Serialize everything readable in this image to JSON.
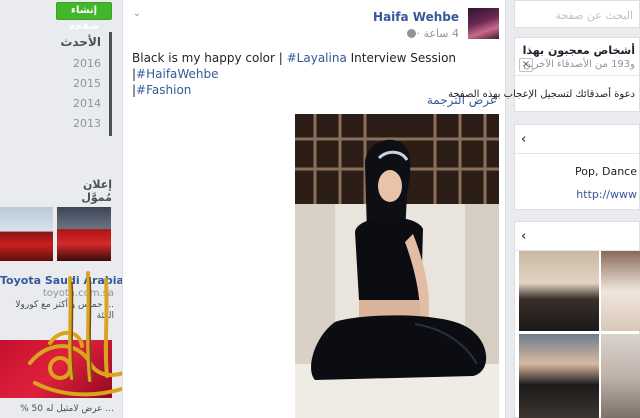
{
  "left": {
    "create_page": "إنشاء صفحة",
    "years": [
      "الأحدث",
      "2016",
      "2015",
      "2014",
      "2013"
    ],
    "sponsored": "إعلان مُموَّل",
    "ad_title": "Toyota Saudi Arabia",
    "ad_url": "toyota.com.sa",
    "ad_desc": "... حماس و أكثر مع كورولا الفئة",
    "ad_footer": "... عرض لامثيل له 50 %"
  },
  "post": {
    "author": "Haifa Wehbe",
    "time": "4 ساعة ·",
    "text_plain1": "Black is my happy color | ",
    "tag1": "#Layalina",
    "text_plain2": " Interview Session |",
    "tag2": "#HaifaWehbe",
    "text_plain3": " |",
    "tag3": "#Fashion",
    "translate": "عرض الترجمة"
  },
  "right": {
    "search_placeholder": "البحث عن صفحة",
    "likes_title": "أشخاص معجبون بهذا",
    "likes_count": "و193 من الأصدقاء الآخرين",
    "invite": "دعوة أصدقائك لتسجيل الإعجاب بهذه الصفحة",
    "about_line1": "Pop, Dance",
    "about_line2": "http://www",
    "colors": {
      "link": "#365899",
      "button_green": "#42b72a",
      "border": "#dddfe2"
    }
  },
  "icons": [
    "chevron-down-icon",
    "globe-icon",
    "close-icon",
    "chevron-left-icon"
  ]
}
